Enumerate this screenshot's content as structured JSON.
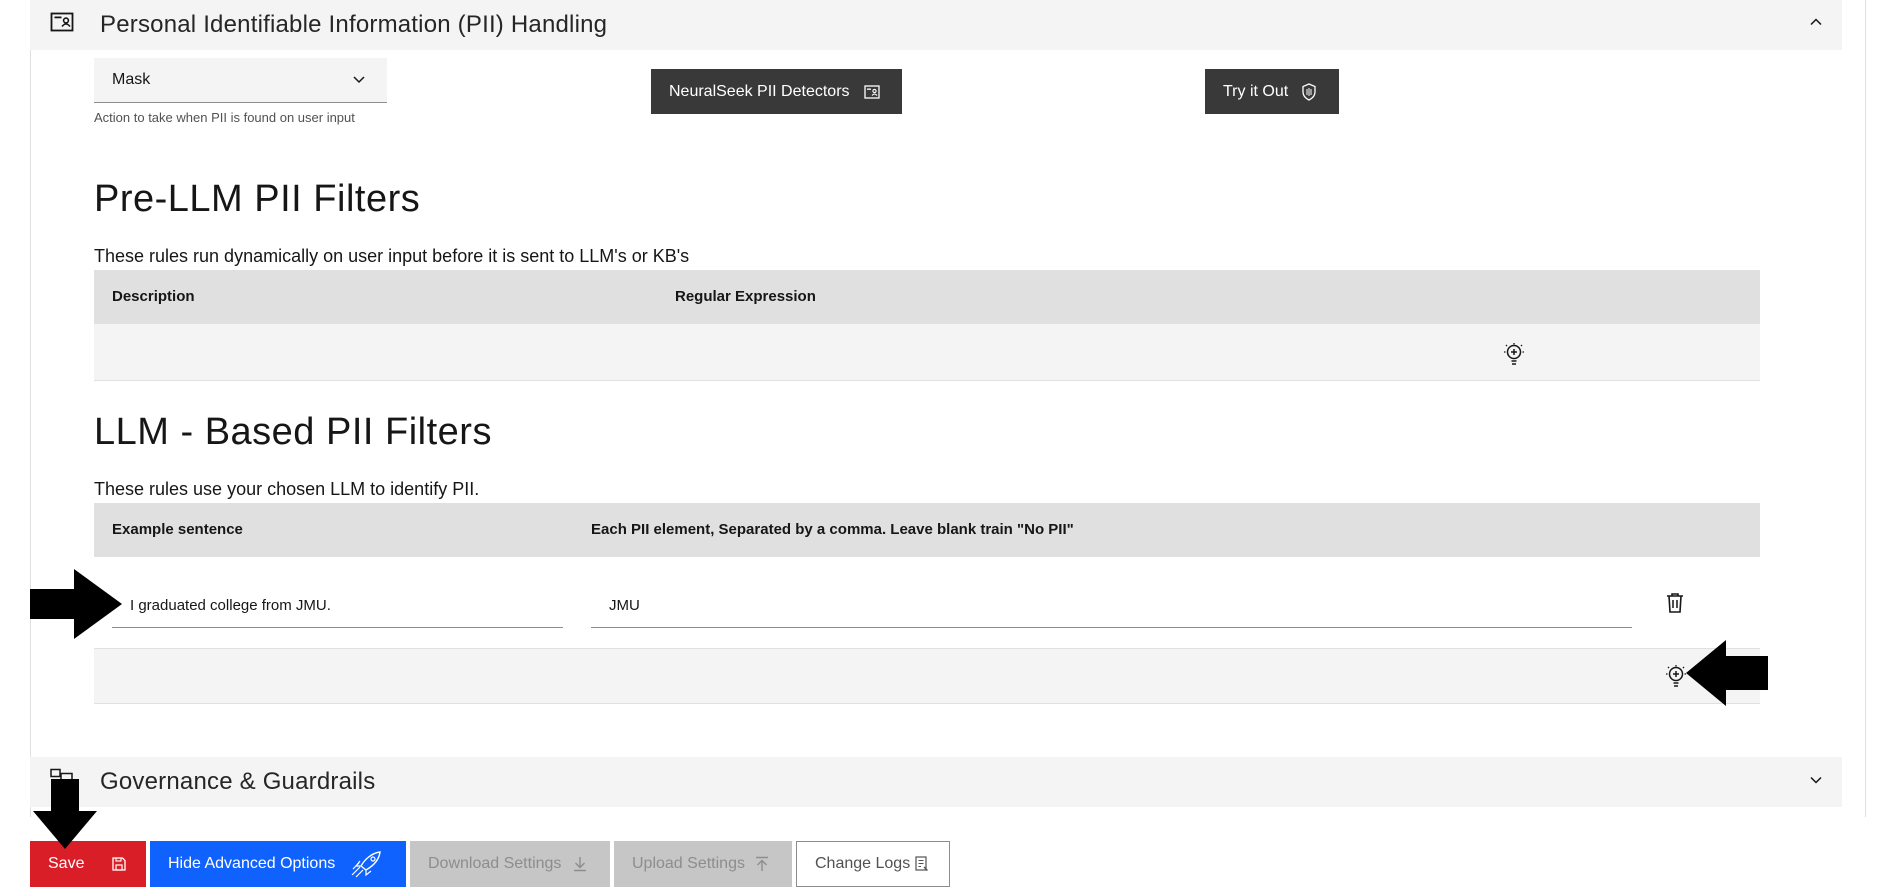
{
  "accordion_pii": {
    "title": "Personal Identifiable Information (PII) Handling",
    "icon": "id-card-icon",
    "expanded": true
  },
  "pii_action": {
    "selected": "Mask",
    "helper": "Action to take when PII is found on user input"
  },
  "buttons": {
    "detectors": "NeuralSeek PII Detectors",
    "try_it_out": "Try it Out"
  },
  "pre_llm": {
    "title": "Pre-LLM PII Filters",
    "description": "These rules run dynamically on user input before it is sent to LLM's or KB's",
    "columns": [
      "Description",
      "Regular Expression"
    ]
  },
  "llm_based": {
    "title": "LLM - Based PII Filters",
    "description": "These rules use your chosen LLM to identify PII.",
    "columns": [
      "Example sentence",
      "Each PII element, Separated by a comma. Leave blank train \"No PII\""
    ],
    "rows": [
      {
        "example": "I graduated college from JMU.",
        "elements": "JMU"
      }
    ]
  },
  "accordion_governance": {
    "title": "Governance & Guardrails",
    "icon": "governance-icon",
    "expanded": false
  },
  "bottom_bar": {
    "save": "Save",
    "hide_advanced": "Hide Advanced Options",
    "download": "Download Settings",
    "upload": "Upload Settings",
    "change_logs": "Change Logs"
  },
  "colors": {
    "save": "#da1e28",
    "primary": "#0f62fe",
    "dark_button": "#393939",
    "disabled": "#c6c6c6"
  }
}
